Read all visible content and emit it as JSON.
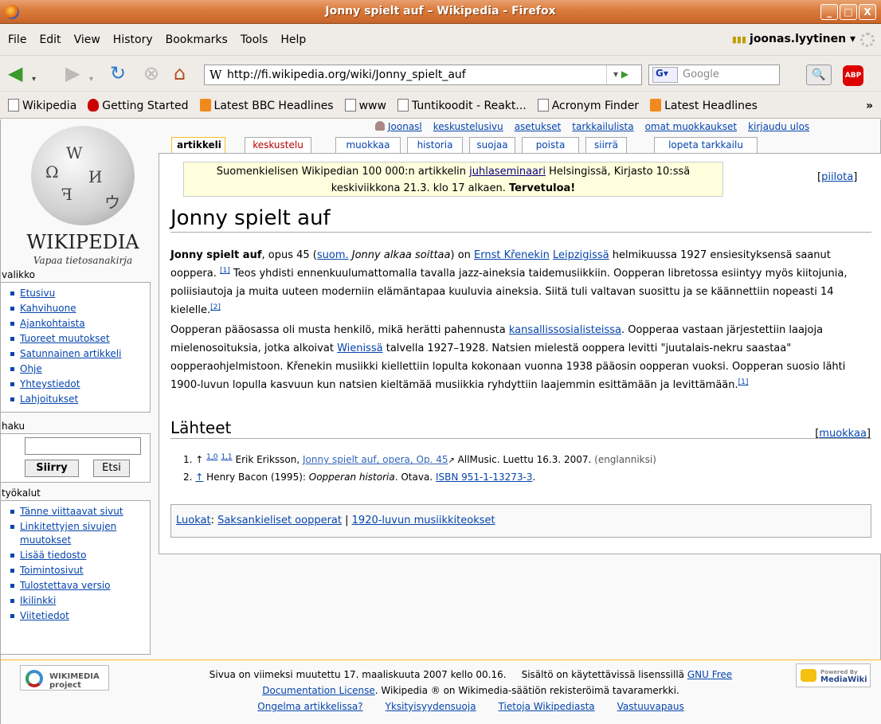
{
  "window": {
    "title": "Jonny spielt auf – Wikipedia - Firefox",
    "buttons": [
      "_",
      "□",
      "X"
    ]
  },
  "menubar": {
    "items": [
      "File",
      "Edit",
      "View",
      "History",
      "Bookmarks",
      "Tools",
      "Help"
    ],
    "user": "joonas.lyytinen ▾"
  },
  "navbar": {
    "url": "http://fi.wikipedia.org/wiki/Jonny_spielt_auf",
    "search_placeholder": "Google",
    "abp": "ABP",
    "icons": [
      "back-icon",
      "forward-icon",
      "reload-icon",
      "stop-icon",
      "home-icon"
    ]
  },
  "bookmarks": {
    "items": [
      {
        "label": "Wikipedia",
        "icon": "page"
      },
      {
        "label": "Getting Started",
        "icon": "gs"
      },
      {
        "label": "Latest BBC Headlines",
        "icon": "rss"
      },
      {
        "label": "www",
        "icon": "page"
      },
      {
        "label": "Tuntikoodit - Reakt...",
        "icon": "page"
      },
      {
        "label": "Acronym Finder",
        "icon": "page"
      },
      {
        "label": "Latest Headlines",
        "icon": "rss"
      }
    ],
    "more": "»"
  },
  "logo": {
    "title": "WIKIPEDIA",
    "subtitle": "Vapaa tietosanakirja"
  },
  "personal": [
    "Joonasl",
    "keskustelusivu",
    "asetukset",
    "tarkkailulista",
    "omat muokkaukset",
    "kirjaudu ulos"
  ],
  "tabs": [
    "artikkeli",
    "keskustelu",
    "muokkaa",
    "historia",
    "suojaa",
    "poista",
    "siirrä",
    "lopeta tarkkailu"
  ],
  "sidebar": {
    "nav_title": "valikko",
    "nav": [
      "Etusivu",
      "Kahvihuone",
      "Ajankohtaista",
      "Tuoreet muutokset",
      "Satunnainen artikkeli",
      "Ohje",
      "Yhteystiedot",
      "Lahjoitukset"
    ],
    "search_title": "haku",
    "go": "Siirry",
    "search": "Etsi",
    "tools_title": "työkalut",
    "tools": [
      "Tänne viittaavat sivut",
      "Linkitettyjen sivujen muutokset",
      "Lisää tiedosto",
      "Toimintosivut",
      "Tulostettava versio",
      "Ikilinkki",
      "Viitetiedot"
    ]
  },
  "sitenotice": {
    "pre": "Suomenkielisen Wikipedian 100 000:n artikkelin ",
    "link": "juhlaseminaari",
    "post": " Helsingissä, Kirjasto 10:ssä",
    "line2": "keskiviikkona 21.3. klo 17 alkaen. ",
    "bold": "Tervetuloa!",
    "hide": "piilota"
  },
  "article": {
    "title": "Jonny spielt auf",
    "p1": {
      "bold": "Jonny spielt auf",
      "t1": ", opus 45 (",
      "l1": "suom.",
      "i1": " Jonny alkaa soittaa",
      "t2": ") on ",
      "l2": "Ernst Křenekin",
      "l3": "Leipzigissä",
      "t3": " helmikuussa 1927 ensiesityksensä saanut ooppera. ",
      "r1": "[1]",
      "t4": " Teos yhdisti ennenkuulumattomalla tavalla jazz-aineksia taidemusiikkiin. Oopperan libretossa esiintyy myös kiitojunia, poliisiautoja ja muita uuteen moderniin elämäntapaa kuuluvia aineksia. Siitä tuli valtavan suosittu ja se käännettiin nopeasti 14 kielelle.",
      "r2": "[2]"
    },
    "p2": {
      "t1": "Oopperan pääosassa oli musta henkilö, mikä herätti pahennusta ",
      "l1": "kansallissosialisteissa",
      "t2": ". Oopperaa vastaan järjestettiin laajoja mielenosoituksia, jotka alkoivat ",
      "l2": "Wienissä",
      "t3": " talvella 1927–1928. Natsien mielestä ooppera levitti \"juutalais-nekru saastaa\" oopperaohjelmistoon. Křenekin musiikki kiellettiin lopulta kokonaan vuonna 1938 pääosin oopperan vuoksi. Oopperan suosio lähti 1900-luvun lopulla kasvuun kun natsien kieltämää musiikkia ryhdyttiin laajemmin esittämään ja levittämään.",
      "r1": "[1]"
    },
    "h2": "Lähteet",
    "edit": "muokkaa",
    "refs": [
      {
        "num": "1.",
        "arrow": "↑",
        "b1": "1,0",
        "b2": "1,1",
        "author": "Erik Eriksson, ",
        "link": "Jonny spielt auf, opera, Op. 45",
        "rest": " AllMusic. Luettu 16.3. 2007. ",
        "lang": "(englanniksi)"
      },
      {
        "num": "2.",
        "arrow": "↑",
        "author": "Henry Bacon (1995): ",
        "italic": "Oopperan historia",
        "rest": ". Otava. ",
        "link": "ISBN 951-1-13273-3",
        "end": "."
      }
    ],
    "cats": {
      "label": "Luokat",
      "sep": ": ",
      "c1": "Saksankieliset oopperat",
      "pipe": " | ",
      "c2": "1920-luvun musiikkiteokset"
    }
  },
  "footer": {
    "wm": "WIKIMEDIA project",
    "mw1": "Powered By",
    "mw2": "MediaWiki",
    "line1": "Sivua on viimeksi muutettu 17. maaliskuuta 2007 kello 00.16.     Sisältö on käytettävissä lisenssillä ",
    "gnu": "GNU Free",
    "doc": "Documentation License",
    "line2": ". Wikipedia ® on Wikimedia-säätiön rekisteröimä tavaramerkki.",
    "links": [
      "Ongelma artikkelissa?",
      "Yksityisyydensuoja",
      "Tietoja Wikipediasta",
      "Vastuuvapaus"
    ]
  },
  "colors": {
    "titlebar": "#d97a3a",
    "link": "#0645ad",
    "notice": "#ffffdd"
  }
}
